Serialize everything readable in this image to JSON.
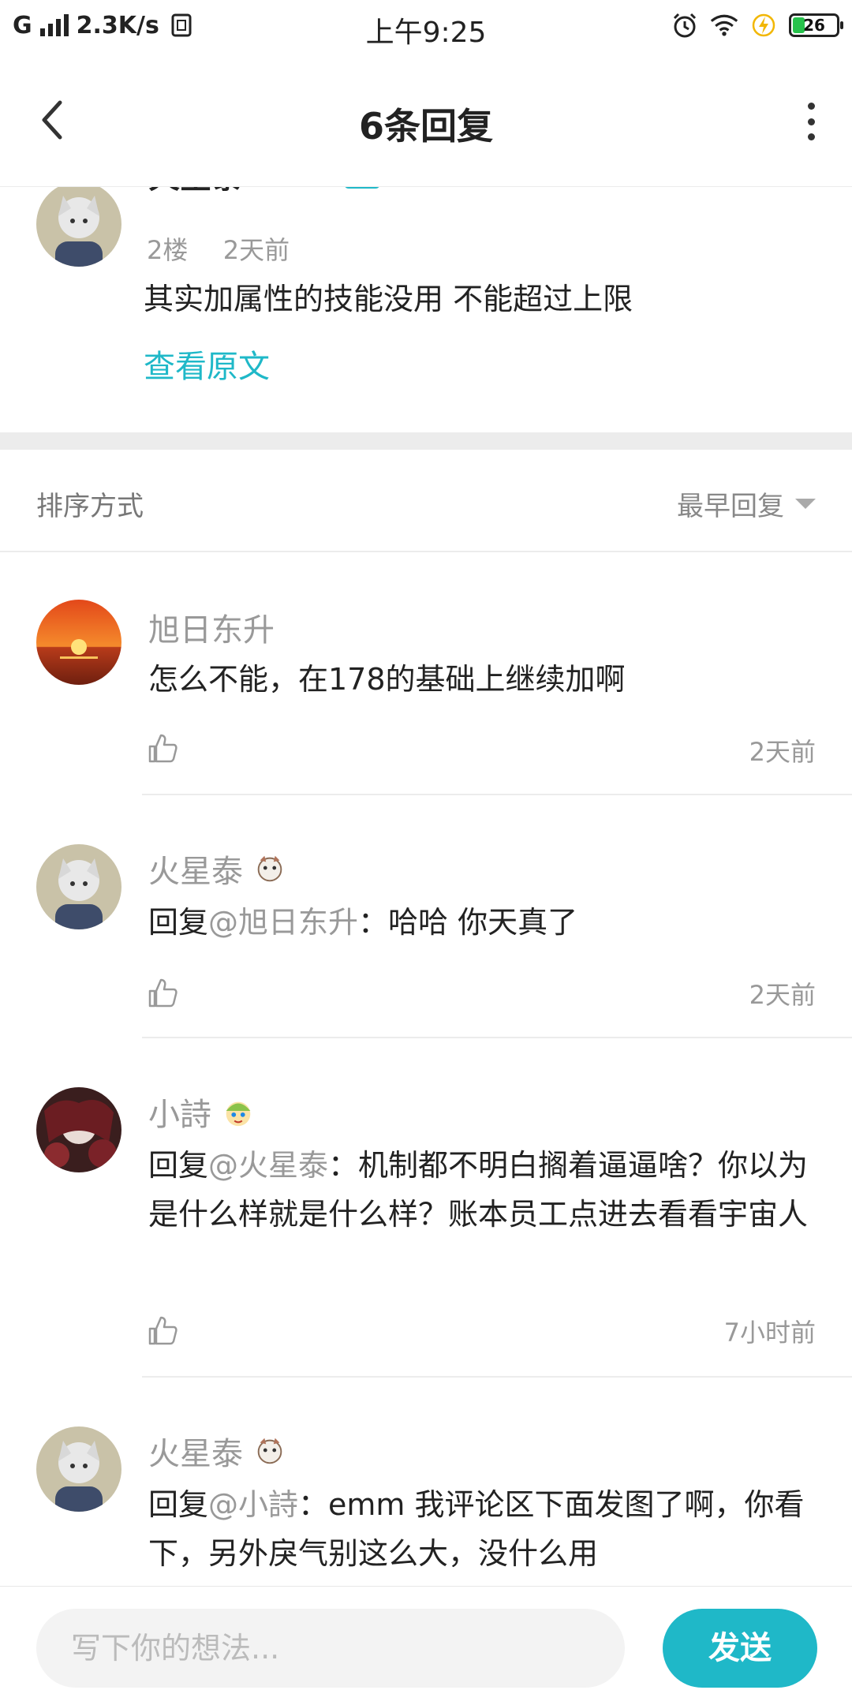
{
  "status_bar": {
    "network": "G",
    "speed": "2.3K/s",
    "time": "上午9:25",
    "battery": "26",
    "icons": [
      "signal-icon",
      "sim-icon",
      "alarm-icon",
      "wifi-icon",
      "charging-icon",
      "battery-icon"
    ]
  },
  "header": {
    "title": "6条回复",
    "back_icon": "back-arrow-icon",
    "more_icon": "more-vertical-icon"
  },
  "origin": {
    "author": "火星泰",
    "badge": "我",
    "floor": "2楼",
    "time": "2天前",
    "text": "其实加属性的技能没用 不能超过上限",
    "view_original": "查看原文"
  },
  "sort": {
    "label": "排序方式",
    "value": "最早回复"
  },
  "replies": [
    {
      "author": "旭日东升",
      "prefix": "",
      "mention": "",
      "text": "怎么不能，在178的基础上继续加啊",
      "time": "2天前"
    },
    {
      "author": "火星泰",
      "prefix": "回复",
      "mention": "@旭日东升",
      "text": "：哈哈 你天真了",
      "time": "2天前"
    },
    {
      "author": "小詩",
      "prefix": "回复",
      "mention": "@火星泰",
      "text": "：机制都不明白搁着逼逼啥？你以为是什么样就是什么样？账本员工点进去看看宇宙人",
      "time": "7小时前"
    },
    {
      "author": "火星泰",
      "prefix": "回复",
      "mention": "@小詩",
      "text": "：emm 我评论区下面发图了啊，你看下，另外戾气别这么大，没什么用",
      "time": ""
    }
  ],
  "composer": {
    "placeholder": "写下你的想法...",
    "send_label": "发送"
  },
  "colors": {
    "accent": "#1fb8c8",
    "muted": "#999999",
    "divider": "#ececec"
  }
}
